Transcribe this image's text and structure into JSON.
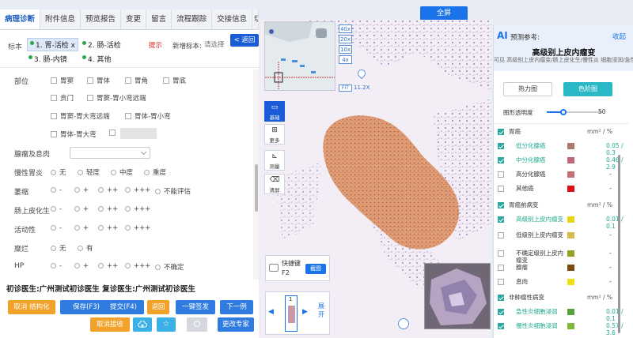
{
  "tabs": [
    {
      "label": "病理诊断",
      "active": true
    },
    {
      "label": "附件信息"
    },
    {
      "label": "预览报告"
    },
    {
      "label": "变更"
    },
    {
      "label": "留言"
    },
    {
      "label": "流程跟踪"
    },
    {
      "label": "交接信息"
    },
    {
      "label": "切"
    }
  ],
  "fullscreen_label": "全屏",
  "specimen": {
    "label": "标本",
    "items": [
      "1. 胃-活检",
      "2. 肠-活检",
      "3. 肠-内镜",
      "4. 其他"
    ],
    "close": "x",
    "hint": "提示",
    "new_label": "新增标本:",
    "new_placeholder": "请选择",
    "back_label": "< 返回"
  },
  "form": {
    "site_label": "部位",
    "sites": [
      "胃窦",
      "胃体",
      "胃角",
      "胃底",
      "贲门",
      "胃窦-胃小弯远端",
      "胃窦-胃大弯远端",
      "胃体-胃小弯",
      "胃体-胃大弯"
    ],
    "gland_label": "腺瘤及息肉",
    "chronic_label": "慢性胃炎",
    "chronic_options": [
      "无",
      "轻度",
      "中度",
      "重度"
    ],
    "atrophy_label": "萎缩",
    "atrophy_options": [
      "-",
      "+",
      "++",
      "+++",
      "不能评估"
    ],
    "metaplasia_label": "肠上皮化生",
    "metaplasia_options": [
      "-",
      "+",
      "++",
      "+++"
    ],
    "activity_label": "活动性",
    "activity_options": [
      "-",
      "+",
      "++",
      "+++"
    ],
    "erosion_label": "糜烂",
    "erosion_options": [
      "无",
      "有"
    ],
    "hp_label": "HP",
    "hp_options": [
      "-",
      "+",
      "++",
      "+++",
      "不确定"
    ]
  },
  "doctors": "初诊医生:广州测试初诊医生 复诊医生:广州测试初诊医生",
  "buttons": {
    "cancel_struct": "取消 结构化",
    "save": "保存(F3)",
    "submit": "提交(F4)",
    "return": "退回",
    "sign": "一键签发",
    "next": "下一例",
    "cancel_receive": "取消接收",
    "change_expert": "更改专家"
  },
  "viewer": {
    "zoom_levels": [
      "40x",
      "20x",
      "10x",
      "4x"
    ],
    "fit_label": "FIT",
    "magnification": "11.2X",
    "tools": [
      {
        "label": "基础",
        "icon": "monitor-icon"
      },
      {
        "label": "更多",
        "icon": "plus-box-icon"
      },
      {
        "label": "测量",
        "icon": "ruler-icon"
      },
      {
        "label": "清屏",
        "icon": "eraser-icon"
      }
    ],
    "shortcut_label": "快捷键",
    "shortcut_key": "F2",
    "screenshot_label": "截图",
    "slide_number": "1",
    "expand_label": "展开"
  },
  "ai_panel": {
    "badge": "AI",
    "title": "预测参考:",
    "collapse": "收起",
    "diagnosis": "高级别上皮内瘤变",
    "description": "可见 高级别上皮内瘤变/肠上皮化生/慢性炎 细胞浸润/急性炎细胞浸润, 局灶鳞为腺癌",
    "heatmap_label": "热力图",
    "color_label": "色阶图",
    "opacity_label": "图形透明度",
    "opacity_value": "50",
    "opacity_fraction": 0.3,
    "unit": "mm² / %",
    "rows": [
      {
        "name": "胃癌",
        "group": true,
        "checked": true,
        "unit": true
      },
      {
        "name": "低分化腺癌",
        "checked": true,
        "color": "#a77b6e",
        "value": "0.05 / 0.3",
        "hl": true
      },
      {
        "name": "中分化腺癌",
        "checked": true,
        "color": "#c2667c",
        "value": "0.46 / 2.9",
        "hl": true
      },
      {
        "name": "高分化腺癌",
        "checked": false,
        "color": "#c77070",
        "value": "-"
      },
      {
        "name": "其他癌",
        "checked": false,
        "color": "#e01010",
        "value": "-"
      },
      {
        "name": "胃癌前病变",
        "group": true,
        "checked": true,
        "unit": true
      },
      {
        "name": "高级别上皮内瘤变",
        "checked": true,
        "color": "#e8d418",
        "value": "0.01 / 0.1",
        "hl": true
      },
      {
        "name": "低级别上皮内瘤变",
        "checked": false,
        "color": "#d6b84c",
        "value": "-"
      },
      {
        "name": "不确定级别上皮内瘤变",
        "checked": false,
        "color": "#9aa020",
        "value": "-"
      },
      {
        "name": "腺瘤",
        "checked": false,
        "color": "#7a4a10",
        "value": "-"
      },
      {
        "name": "息肉",
        "checked": false,
        "color": "#f0e010",
        "value": "-"
      },
      {
        "name": "非肿瘤性病变",
        "group": true,
        "checked": true,
        "unit": true
      },
      {
        "name": "急性炎细胞浸润",
        "checked": true,
        "color": "#58a03c",
        "value": "0.01 / 0.1",
        "hl": true
      },
      {
        "name": "慢性炎细胞浸润",
        "checked": true,
        "color": "#80b838",
        "value": "0.57 / 3.6",
        "hl": true
      }
    ]
  },
  "colors": {
    "accent": "#1a73e8",
    "tissue": "#e8a070"
  }
}
